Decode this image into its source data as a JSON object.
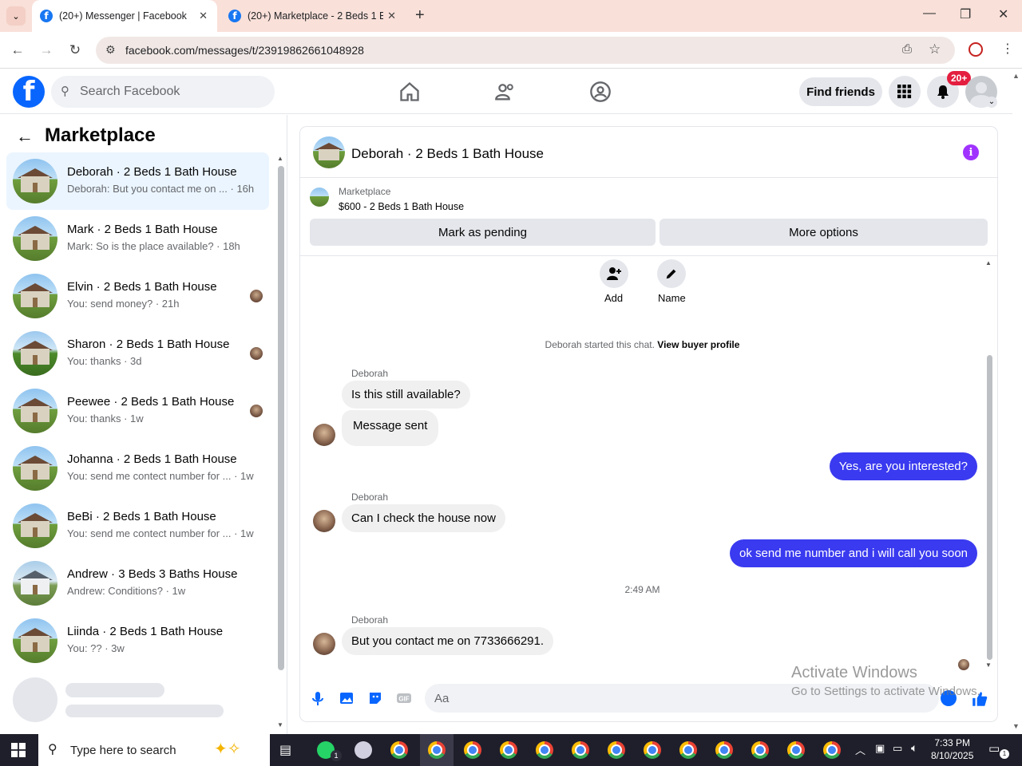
{
  "browser": {
    "tabs": [
      {
        "title": "(20+) Messenger | Facebook",
        "active": true
      },
      {
        "title": "(20+) Marketplace - 2 Beds 1 B",
        "active": false
      }
    ],
    "new_tab": "+",
    "url": "facebook.com/messages/t/23919862661048928"
  },
  "fb_header": {
    "logo": "f",
    "search_placeholder": "Search Facebook",
    "find_friends": "Find friends",
    "notification_badge": "20+"
  },
  "sidebar": {
    "title": "Marketplace",
    "conversations": [
      {
        "name": "Deborah · 2 Beds 1 Bath House",
        "preview": "Deborah: But you contact me on ... · 16h",
        "selected": true
      },
      {
        "name": "Mark · 2 Beds 1 Bath House",
        "preview": "Mark: So is the place available? · 18h"
      },
      {
        "name": "Elvin · 2 Beds 1 Bath House",
        "preview": "You: send money? · 21h"
      },
      {
        "name": "Sharon · 2 Beds 1 Bath House",
        "preview": "You: thanks · 3d"
      },
      {
        "name": "Peewee · 2 Beds 1 Bath House",
        "preview": "You: thanks · 1w"
      },
      {
        "name": "Johanna · 2 Beds 1 Bath House",
        "preview": "You: send me contect number for ... · 1w"
      },
      {
        "name": "BeBi · 2 Beds 1 Bath House",
        "preview": "You: send me contect number for ... · 1w"
      },
      {
        "name": "Andrew · 3 Beds 3 Baths House",
        "preview": "Andrew: Conditions? · 1w"
      },
      {
        "name": "Liinda · 2 Beds 1 Bath House",
        "preview": "You: ?? · 3w"
      }
    ]
  },
  "chat": {
    "title": "Deborah · 2 Beds 1 Bath House",
    "listing_label": "Marketplace",
    "listing_title": "$600 - 2 Beds 1 Bath House",
    "mark_pending": "Mark as pending",
    "more_options": "More options",
    "add_label": "Add",
    "name_label": "Name",
    "started_text": "Deborah started this chat.",
    "view_profile": "View buyer profile",
    "messages": [
      {
        "sender": "Deborah",
        "text": "Is this still available?"
      },
      {
        "text": "Message sent"
      },
      {
        "text": "Yes, are you interested?"
      },
      {
        "sender": "Deborah",
        "text": "Can I check the house now"
      },
      {
        "text": "ok send me number and i will call you soon"
      },
      {
        "timestamp": "2:49 AM"
      },
      {
        "sender": "Deborah",
        "text": "But you contact me on 7733666291."
      }
    ],
    "composer_placeholder": "Aa"
  },
  "watermark": {
    "line1": "Activate Windows",
    "line2": "Go to Settings to activate Windows."
  },
  "taskbar": {
    "search_placeholder": "Type here to search",
    "time": "7:33 PM",
    "date": "8/10/2025",
    "whatsapp_badge": "1"
  },
  "colors": {
    "fb_blue": "#0866ff",
    "outgoing_bubble": "#3a3af0",
    "selected_row": "#ebf5ff",
    "badge_red": "#e41e3f"
  }
}
